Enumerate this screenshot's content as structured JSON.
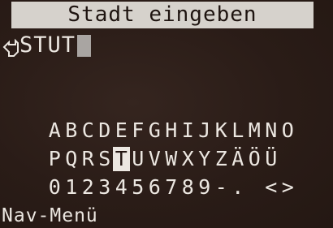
{
  "header": {
    "title": "Stadt eingeben"
  },
  "entry": {
    "value": "STUT",
    "cursor_icon": "hand-pointer-icon"
  },
  "keyboard": {
    "rows": [
      [
        "A",
        "B",
        "C",
        "D",
        "E",
        "F",
        "G",
        "H",
        "I",
        "J",
        "K",
        "L",
        "M",
        "N",
        "O"
      ],
      [
        "P",
        "Q",
        "R",
        "S",
        "T",
        "U",
        "V",
        "W",
        "X",
        "Y",
        "Z",
        "Ä",
        "Ö",
        "Ü"
      ],
      [
        "0",
        "1",
        "2",
        "3",
        "4",
        "5",
        "6",
        "7",
        "8",
        "9",
        "-",
        ".",
        " ",
        "<",
        ">"
      ]
    ],
    "selected": "T"
  },
  "footer": {
    "label": "Nav-Menü"
  },
  "colors": {
    "background": "#2b1d18",
    "title_bar": "#d6d2cc",
    "text": "#ece7e1",
    "caret": "#a9a5a2"
  }
}
